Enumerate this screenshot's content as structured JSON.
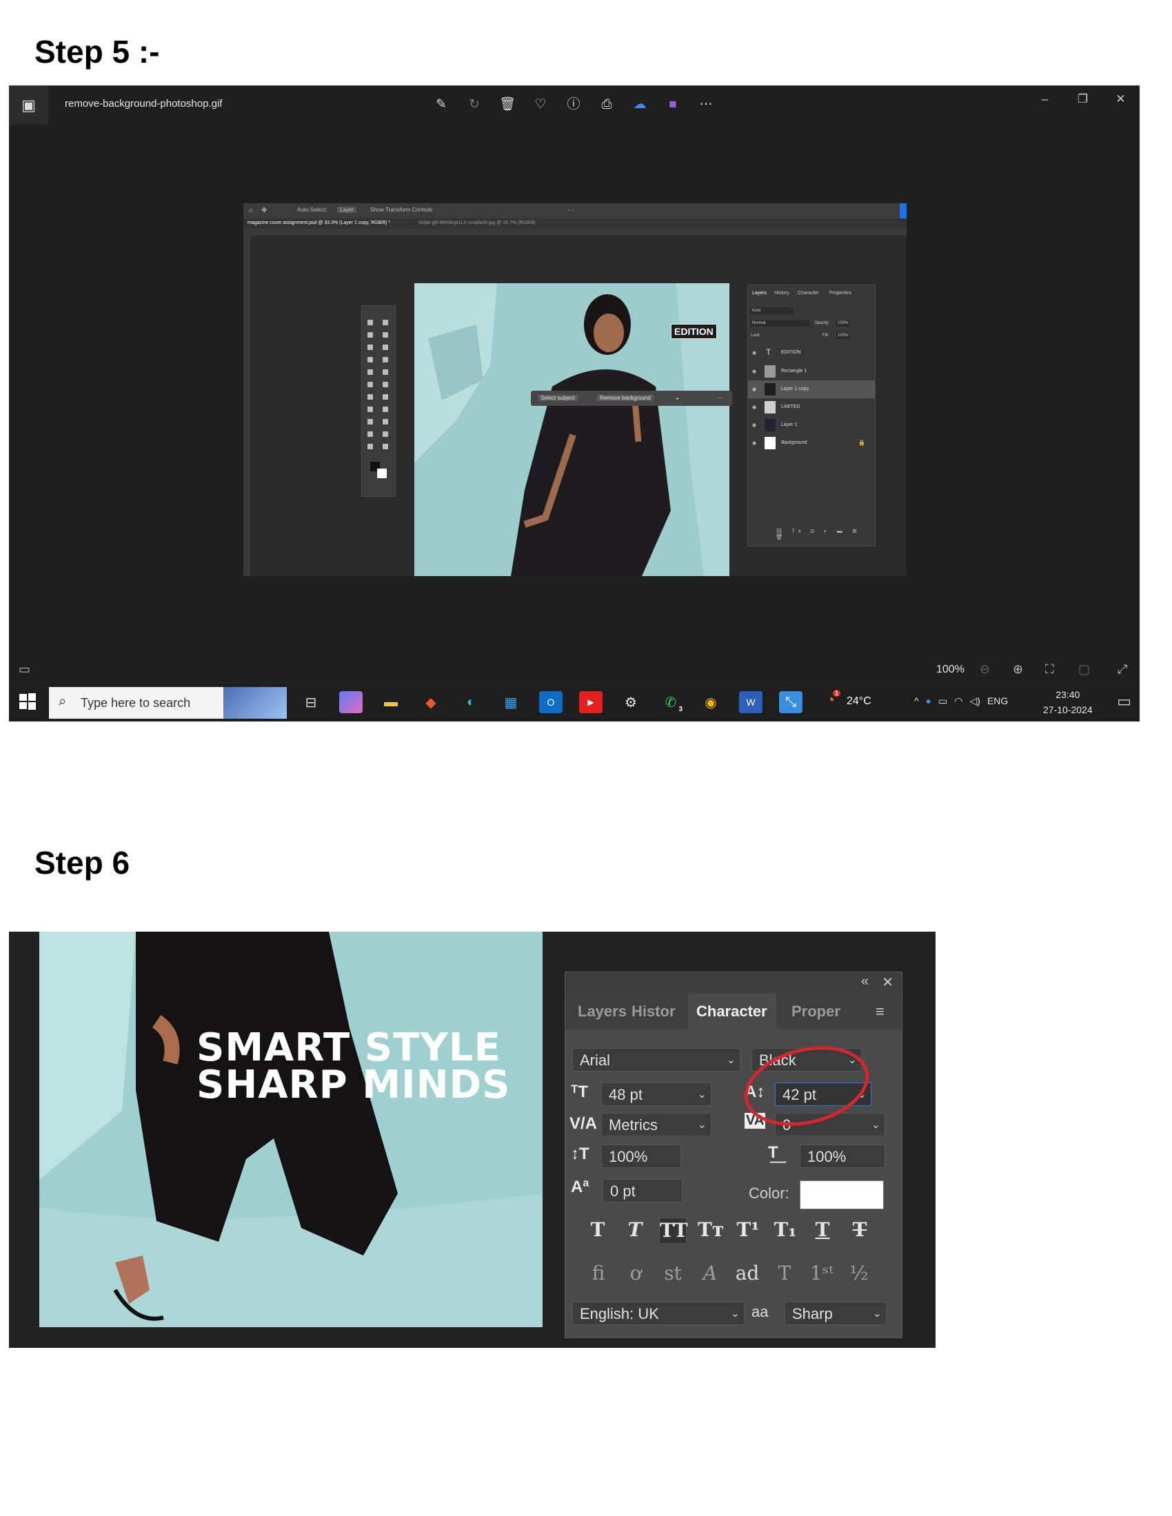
{
  "step5": {
    "heading": "Step 5 :-",
    "viewer": {
      "filename": "remove-background-photoshop.gif",
      "toolbar_icons": [
        "edit-icon",
        "rotate-icon",
        "delete-icon",
        "favorite-icon",
        "info-icon",
        "print-icon",
        "onedrive-icon",
        "clipchamp-icon",
        "more-icon"
      ],
      "window_controls": [
        "minimize",
        "restore",
        "close"
      ],
      "zoom": "100%"
    },
    "photoshop": {
      "options": {
        "auto_select": "Auto-Select:",
        "layer": "Layer",
        "transform": "Show Transform Controls"
      },
      "tabs": [
        "magazine cover assignment.psd @ 33.3% (Layer 1 copy, RGB/8) *",
        "dollar-gill-4KKbegt1LX-unsplash.jpg @ 16.7% (RGB/8)"
      ],
      "canvas_label": "EDITION",
      "context_bar": {
        "select_subject": "Select subject",
        "remove_background": "Remove background"
      },
      "panel_tabs": [
        "Layers",
        "History",
        "Character",
        "Properties"
      ],
      "panel_controls": {
        "kind": "Kind",
        "mode": "Normal",
        "opacity": "Opacity:",
        "opacity_value": "100%",
        "lock": "Lock:",
        "fill": "Fill:",
        "fill_value": "100%"
      },
      "layers": [
        "EDITION",
        "Rectangle 1",
        "Layer 1 copy",
        "LIMITED",
        "Layer 1",
        "Background"
      ]
    },
    "taskbar": {
      "search_placeholder": "Type here to search",
      "apps": [
        "task-view",
        "copilot",
        "file-explorer",
        "brave",
        "edge",
        "store",
        "outlook",
        "youtube",
        "settings",
        "whatsapp",
        "chrome",
        "word",
        "photos"
      ],
      "whatsapp_badge": "3",
      "weather_badge": "1",
      "temperature": "24°C",
      "language": "ENG",
      "time": "23:40",
      "date": "27-10-2024"
    }
  },
  "step6": {
    "heading": "Step 6",
    "headline": [
      "SMART STYLE",
      "SHARP MINDS"
    ],
    "character_panel": {
      "tabs": [
        "Layers",
        "Histor",
        "Character",
        "Proper"
      ],
      "font_family": "Arial",
      "font_style": "Black",
      "font_size": "48 pt",
      "leading": "42 pt",
      "kerning": "Metrics",
      "tracking": "0",
      "vertical_scale": "100%",
      "horizontal_scale": "100%",
      "baseline_shift": "0 pt",
      "color_label": "Color:",
      "language": "English: UK",
      "antialias_label": "aa",
      "antialias": "Sharp"
    }
  }
}
